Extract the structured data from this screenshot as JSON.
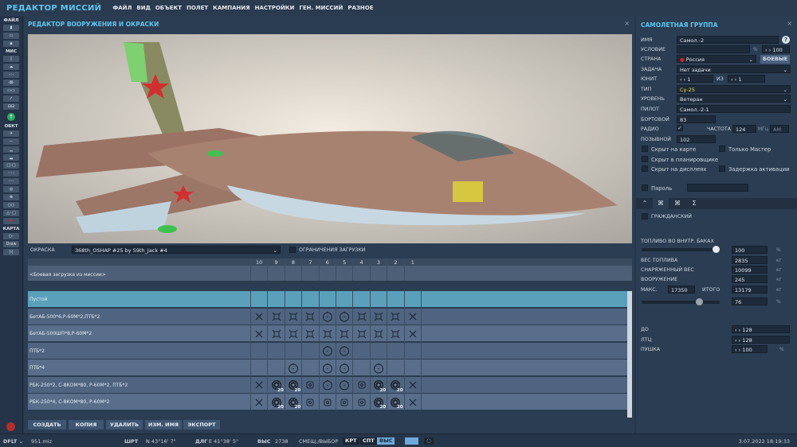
{
  "app_title": "РЕДАКТОР МИССИЙ",
  "menu": [
    "ФАЙЛ",
    "ВИД",
    "ОБЪЕКТ",
    "ПОЛЕТ",
    "КАМПАНИЯ",
    "НАСТРОЙКИ",
    "ГЕН. МИССИЙ",
    "РАЗНОЕ"
  ],
  "toolbar": {
    "file": "ФАЙЛ",
    "mis": "МИС",
    "obj": "ОБКТ",
    "map": "КАРТА",
    "draw": "Draw"
  },
  "editor": {
    "title": "РЕДАКТОР ВООРУЖЕНИЯ И ОКРАСКИ",
    "livery_label": "ОКРАСКА",
    "livery_value": "368th_OSHAP #25 by 59th_Jack #4",
    "restrictions_label": "ОГРАНИЧЕНИЯ ЗАГРУЗКИ",
    "columns": [
      "10",
      "9",
      "8",
      "7",
      "6",
      "5",
      "4",
      "3",
      "2",
      "1"
    ],
    "mission_loadout": "<Боевая загрузка из миссии>",
    "rows": [
      {
        "name": "Пустой",
        "cells": [
          "",
          "",
          "",
          "",
          "",
          "",
          "",
          "",
          "",
          ""
        ],
        "selected": true
      },
      {
        "name": "БетАБ-500*6,Р-60М*2,ПТБ*2",
        "cells": [
          "x",
          "q",
          "q",
          "q",
          "c",
          "c",
          "q",
          "q",
          "q",
          "x"
        ]
      },
      {
        "name": "БетАБ-500ШП*8,Р-60М*2",
        "cells": [
          "x",
          "q",
          "q",
          "q",
          "q",
          "q",
          "q",
          "q",
          "q",
          "x"
        ]
      },
      {
        "name": "ПТБ*2",
        "cells": [
          "",
          "",
          "",
          "",
          "c",
          "c",
          "",
          "",
          "",
          ""
        ]
      },
      {
        "name": "ПТБ*4",
        "cells": [
          "",
          "",
          "c",
          "",
          "c",
          "c",
          "",
          "c",
          "",
          ""
        ]
      },
      {
        "name": "РБК-250*2, С-8КОМ*80, Р-60М*2, ПТБ*2",
        "cells": [
          "x",
          "r",
          "r",
          "d",
          "c",
          "c",
          "d",
          "r",
          "r",
          "x"
        ]
      },
      {
        "name": "РБК-250*4, С-8КОМ*80, Р-60М*2",
        "cells": [
          "x",
          "r",
          "r",
          "d",
          "d",
          "d",
          "d",
          "r",
          "r",
          "x"
        ]
      }
    ],
    "rocket_count": "20",
    "buttons": [
      "СОЗДАТЬ",
      "КОПИЯ",
      "УДАЛИТЬ",
      "ИЗМ. ИМЯ",
      "ЭКСПОРТ"
    ]
  },
  "group": {
    "title": "САМОЛЕТНАЯ ГРУППА",
    "name_label": "ИМЯ",
    "name": "Самол.-2",
    "condition_label": "УСЛОВИЕ",
    "condition_pct": "%",
    "condition_value": "100",
    "country_label": "СТРАНА",
    "country": "Россия",
    "combat_btn": "БОЕВЫЕ",
    "task_label": "ЗАДАЧА",
    "task": "Нет задачи",
    "unit_label": "ЮНИТ",
    "unit": "1",
    "of_label": "ИЗ",
    "unit_total": "1",
    "type_label": "ТИП",
    "type": "Су-25",
    "skill_label": "УРОВЕНЬ",
    "skill": "Ветеран",
    "pilot_label": "ПИЛОТ",
    "pilot": "Самол.-2-1",
    "board_label": "БОРТОВОЙ",
    "board": "83",
    "radio_label": "РАДИО",
    "freq_label": "ЧАСТОТА",
    "freq": "124",
    "freq_unit": "МГц",
    "modulation": "AM",
    "callsign_label": "ПОЗЫВНОЙ",
    "callsign": "102",
    "hidden_map": "Скрыт на карте",
    "master_only": "Только Мастер",
    "hidden_planner": "Скрыт в планировщике",
    "hidden_display": "Скрыт на дисплеях",
    "late_activation": "Задержка активации",
    "password": "Пароль",
    "civil": "ГРАЖДАНСКИЙ",
    "fuel_label": "ТОПЛИВО ВО ВНУТР. БАКАХ",
    "fuel_pct": "100",
    "fuel_fraction": 1.0,
    "fuel_weight_label": "ВЕС ТОПЛИВА",
    "fuel_weight": "2835",
    "empty_weight_label": "СНАРЯЖЕННЫЙ ВЕС",
    "empty_weight": "10099",
    "weapons_label": "ВООРУЖЕНИЕ",
    "weapons": "245",
    "max_label": "МАКС.",
    "max": "17350",
    "total_label": "ИТОГО",
    "total": "13179",
    "total_pct": "76",
    "total_fraction": 0.76,
    "kg": "кг",
    "pct": "%",
    "chaff_label": "ДО",
    "chaff": "128",
    "flare_label": "ЛТЦ",
    "flare": "128",
    "gun_label": "ПУШКА",
    "gun": "100"
  },
  "status": {
    "file": "951.miz",
    "lat_label": "ШРТ",
    "lat": "N 43°16' 7\"",
    "lon_label": "ДЛГ",
    "lon": "E 41°38' 5\"",
    "alt_label": "ВЫС",
    "alt": "2738",
    "offset_label": "СМЕЩ./ВЫБОР",
    "krt": "КРТ",
    "spt": "СПТ",
    "vys": "ВЫС",
    "datetime": "3.07.2022 18:19:33"
  },
  "colors": {
    "accent": "#5ec6ef",
    "selected_row": "#5aa0bb",
    "type_text": "#f0e040"
  }
}
